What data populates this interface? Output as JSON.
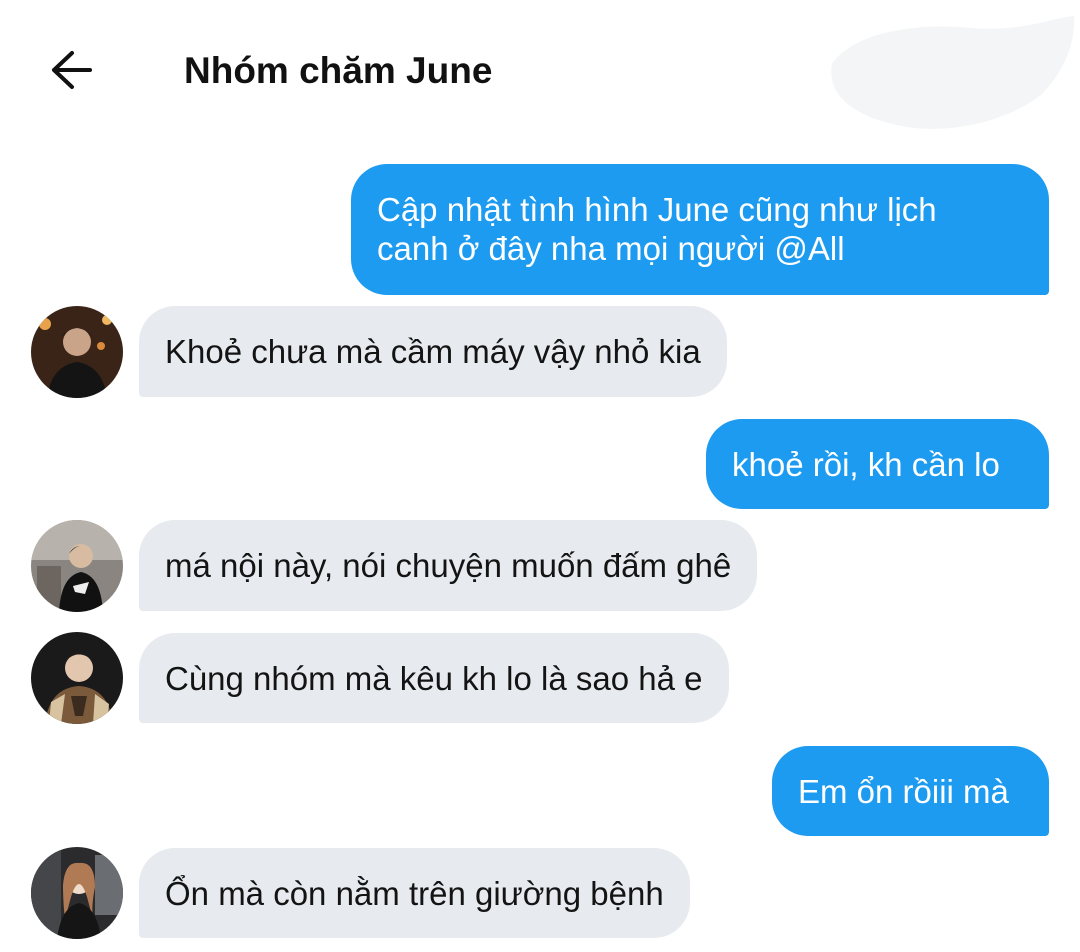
{
  "header": {
    "title": "Nhóm chăm June",
    "back_icon": "arrow-left-icon"
  },
  "colors": {
    "outgoing_bubble": "#1d9bf0",
    "incoming_bubble": "#e7ebef",
    "outgoing_text": "#ffffff",
    "incoming_text": "#141414"
  },
  "messages": [
    {
      "direction": "outgoing",
      "lines": [
        "Cập nhật tình hình June cũng như lịch",
        "canh ở đây nha mọi người @All"
      ]
    },
    {
      "direction": "incoming",
      "text": "Khoẻ chưa mà cầm máy vậy nhỏ kia",
      "avatar": "avatar-1"
    },
    {
      "direction": "outgoing",
      "text": "khoẻ rồi, kh cần lo"
    },
    {
      "direction": "incoming",
      "text": "má nội này, nói chuyện muốn đấm ghê",
      "avatar": "avatar-2"
    },
    {
      "direction": "incoming",
      "text": "Cùng nhóm mà kêu kh lo là sao hả e",
      "avatar": "avatar-3"
    },
    {
      "direction": "outgoing",
      "text": "Em ổn rồiii mà"
    },
    {
      "direction": "incoming",
      "text": "Ổn mà còn nằm trên giường bệnh",
      "avatar": "avatar-4"
    }
  ]
}
